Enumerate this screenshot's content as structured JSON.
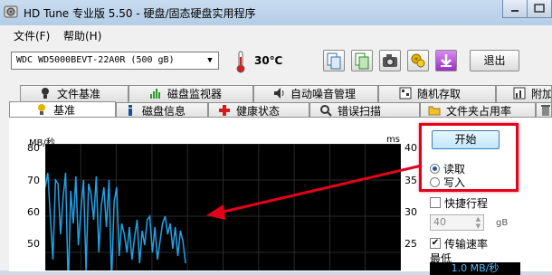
{
  "window": {
    "title": "HD Tune 专业版 5.50 - 硬盘/固态硬盘实用程序"
  },
  "menu": {
    "file": "文件(F)",
    "help": "帮助(H)"
  },
  "toolbar": {
    "drive": "WDC    WD5000BEVT-22A0R (500 gB)",
    "temperature": "30℃",
    "exit_label": "退出",
    "icons": [
      "copy-text-icon",
      "copy-screenshot-icon",
      "camera-icon",
      "options-icon",
      "save-icon"
    ]
  },
  "tabs": {
    "row1": [
      "文件基准",
      "磁盘监视器",
      "自动噪音管理",
      "随机存取",
      "附加"
    ],
    "row2": [
      "基准",
      "磁盘信息",
      "健康状态",
      "错误扫描",
      "文件夹占用率"
    ]
  },
  "chart_data": {
    "type": "line",
    "ylabel_left": "MB/秒",
    "ylabel_right": "ms",
    "left_ticks": [
      "80",
      "70",
      "60",
      "50"
    ],
    "right_ticks": [
      "40",
      "35",
      "30",
      "25"
    ],
    "series": [
      {
        "color": "#1fa3e8",
        "values": [
          68,
          72,
          60,
          48,
          70,
          69,
          55,
          65,
          72,
          40,
          67,
          58,
          71,
          52,
          62,
          70,
          45,
          69,
          66,
          59,
          71,
          50,
          63,
          68,
          57,
          70,
          42,
          64,
          68,
          49,
          58,
          55,
          50,
          57,
          48,
          54,
          59,
          47,
          56,
          52,
          59,
          60,
          50,
          57,
          48,
          53,
          58,
          60,
          55,
          58,
          51,
          57,
          49,
          56,
          53,
          47
        ]
      }
    ],
    "ylim": [
      45,
      80
    ]
  },
  "options": {
    "start_label": "开始",
    "read_label": "读取",
    "write_label": "写入",
    "mode": "read",
    "short_stroke_label": "快捷行程",
    "short_stroke_checked": false,
    "short_stroke_value": "40",
    "short_stroke_unit": "gB",
    "transfer_rate_label": "传输速率",
    "transfer_rate_checked": true,
    "min_label": "最低",
    "min_value": "1.0 MB/秒"
  },
  "colors": {
    "annotation": "#e3001b",
    "chart_line": "#1fa3e8",
    "chart_bg": "#000000"
  }
}
